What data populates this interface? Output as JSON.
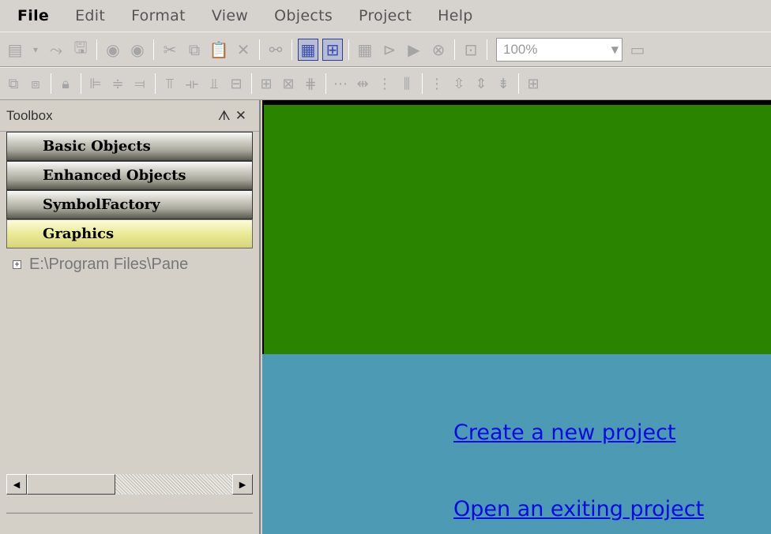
{
  "menu": [
    "File",
    "Edit",
    "Format",
    "View",
    "Objects",
    "Project",
    "Help"
  ],
  "toolbar1": {
    "zoom_value": "100%",
    "icons": [
      "new-form-icon",
      "open-icon",
      "save-icon",
      "undo-icon",
      "redo-icon",
      "cut-icon",
      "copy-icon",
      "paste-icon",
      "delete-icon",
      "find-icon",
      "grid-icon",
      "snap-icon",
      "compile-icon",
      "transfer-icon",
      "run-icon",
      "stop-icon",
      "download-icon",
      "zoom-select",
      "window-icon"
    ]
  },
  "toolbar2": {
    "icons": [
      "group-icon",
      "ungroup-icon",
      "lock-icon",
      "align-left-icon",
      "align-center-icon",
      "align-right-icon",
      "align-top-icon",
      "align-middle-icon",
      "align-bottom-icon",
      "same-width-icon",
      "same-height-icon",
      "same-size-icon",
      "center-icon",
      "h-spacing-equal-icon",
      "h-spacing-increase-icon",
      "h-spacing-decrease-icon",
      "h-spacing-remove-icon",
      "v-spacing-equal-icon",
      "v-spacing-increase-icon",
      "v-spacing-decrease-icon",
      "v-spacing-remove-icon",
      "center-horizontal-icon"
    ]
  },
  "toolbox": {
    "title": "Toolbox",
    "pin_glyph": "ᗑ",
    "close_glyph": "✕",
    "categories": [
      {
        "label": "Basic Objects",
        "active": false
      },
      {
        "label": "Enhanced Objects",
        "active": false
      },
      {
        "label": "SymbolFactory",
        "active": false
      },
      {
        "label": "Graphics",
        "active": true
      }
    ],
    "tree": [
      {
        "label": "E:\\Program Files\\Pane"
      }
    ]
  },
  "canvas": {
    "top_color": "#2b8400",
    "bottom_color": "#4c9ab3",
    "links": {
      "create": "Create a new project",
      "open": "Open an exiting project"
    }
  }
}
